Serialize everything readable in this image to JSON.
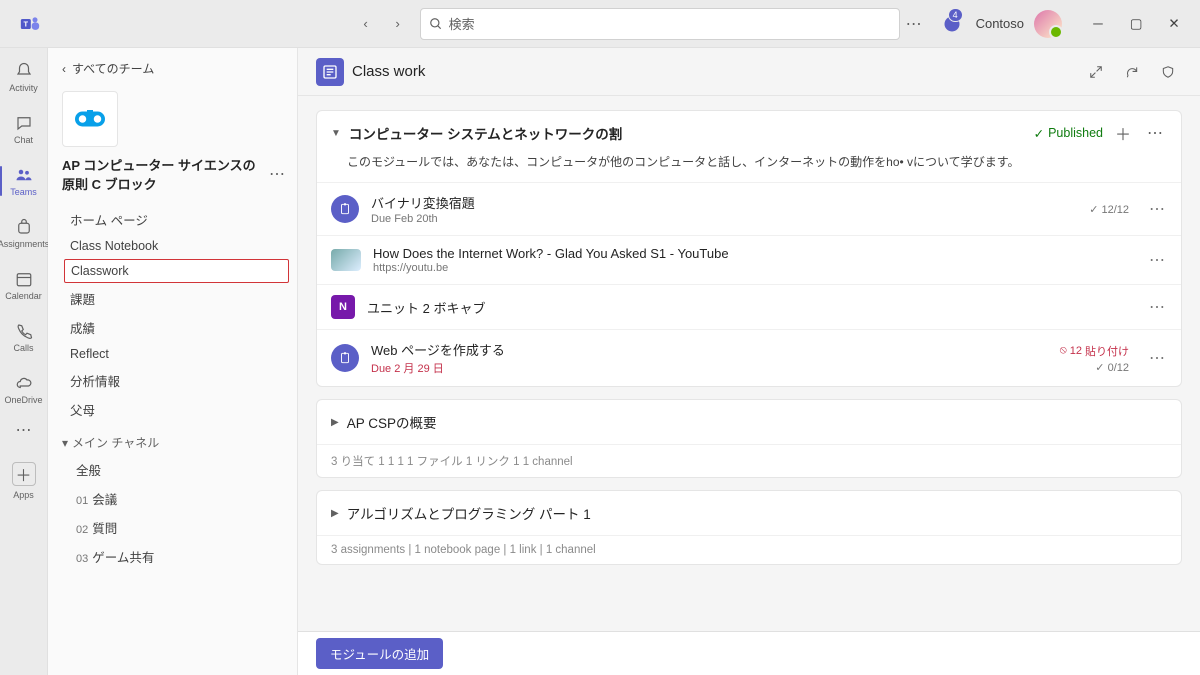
{
  "titlebar": {
    "search_placeholder": "検索",
    "org_name": "Contoso",
    "notification_count": "4"
  },
  "leftrail": {
    "items": [
      {
        "label": "Activity"
      },
      {
        "label": "Chat"
      },
      {
        "label": "Teams"
      },
      {
        "label": "Assignments"
      },
      {
        "label": "Calendar"
      },
      {
        "label": "Calls"
      },
      {
        "label": "OneDrive"
      }
    ],
    "apps_label": "Apps"
  },
  "channels": {
    "back_label": "すべてのチーム",
    "team_name": "AP コンピューター サイエンスの原則 C ブロック",
    "items": [
      {
        "label": "ホーム ページ"
      },
      {
        "label": "Class Notebook"
      },
      {
        "label": "Classwork"
      },
      {
        "label": "課題"
      },
      {
        "label": "成績"
      },
      {
        "label": "Reflect"
      },
      {
        "label": "分析情報"
      },
      {
        "label": "父母"
      }
    ],
    "section_label": "メイン チャネル",
    "sub_channels": [
      {
        "label": "全般"
      },
      {
        "num": "01",
        "label": "会議"
      },
      {
        "num": "02",
        "label": "質問"
      },
      {
        "num": "03",
        "label": "ゲーム共有"
      }
    ]
  },
  "tab": {
    "title": "Class work"
  },
  "modules": [
    {
      "expanded": true,
      "title": "コンピューター システムとネットワークの割",
      "published_label": "Published",
      "description": "このモジュールでは、あなたは、コンピュータが他のコンピュータと話し、インターネットの動作をho• vについて学びます。",
      "items": [
        {
          "type": "assign",
          "title": "バイナリ変換宿題",
          "sub": "Due Feb 20th",
          "right_check": "12/12"
        },
        {
          "type": "link",
          "title": "How Does the Internet Work? - Glad You Asked S1 - YouTube",
          "sub": "https://youtu.be"
        },
        {
          "type": "onenote",
          "title": "ユニット 2 ボキャブ"
        },
        {
          "type": "assign",
          "title": "Web ページを作成する",
          "sub": "Due 2 月 29 日",
          "sub_red": true,
          "late_count": "12",
          "late_label": "貼り付け",
          "right_check": "0/12"
        }
      ]
    },
    {
      "expanded": false,
      "title": "AP CSPの概要",
      "footer": "3 り当て 1 1 1 1 ファイル 1 リンク 1 1           channel"
    },
    {
      "expanded": false,
      "title": "アルゴリズムとプログラミング パート 1",
      "footer": "3 assignments  |  1 notebook page  |  1 link  |  1 channel"
    }
  ],
  "bottom": {
    "add_module": "モジュールの追加"
  }
}
